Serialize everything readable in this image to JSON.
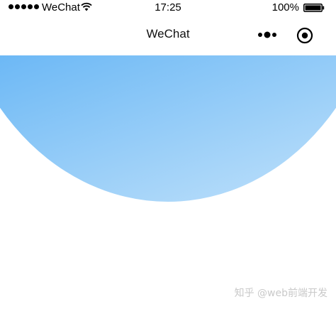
{
  "status_bar": {
    "carrier": "WeChat",
    "time": "17:25",
    "battery": "100%"
  },
  "nav": {
    "title": "WeChat"
  },
  "header_gradient": {
    "from": "#1e8ef0",
    "to": "#c4e3fb"
  },
  "watermark": {
    "text": "知乎 @web前端开发"
  }
}
